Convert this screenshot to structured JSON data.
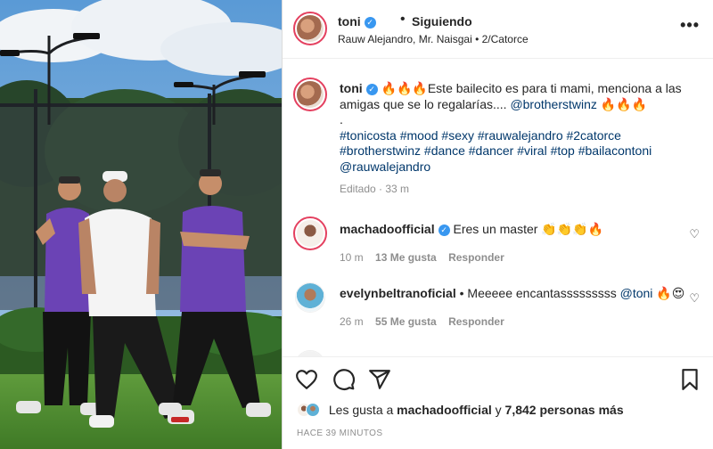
{
  "post": {
    "username": "toni",
    "follow_status": "Siguiendo",
    "audio": "Rauw Alejandro, Mr. Naisgai • 2/Catorce"
  },
  "caption": {
    "username": "toni",
    "text_fire_prefix": "🔥🔥🔥",
    "text_main": "Este bailecito es para ti mami, menciona a las amigas que se lo regalarías....",
    "mention": "@brotherstwinz",
    "text_fire_suffix": "🔥🔥🔥",
    "dot": ".",
    "hashtags": "#tonicosta #mood #sexy #rauwalejandro #2catorce #brotherstwinz #dance #dancer #viral #top #bailacontoni @rauwalejandro",
    "edited": "Editado",
    "age": "33 m"
  },
  "comments": [
    {
      "username": "machadoofficial",
      "verified": true,
      "text": "Eres un master 👏👏👏🔥",
      "age": "10 m",
      "likes": "13 Me gusta",
      "reply": "Responder"
    },
    {
      "username": "evelynbeltranoficial",
      "verified": false,
      "text": "Meeeee encantasssssssss",
      "mention": "@toni",
      "emoji": "🔥😍",
      "age": "26 m",
      "likes": "55 Me gusta",
      "reply": "Responder"
    }
  ],
  "likes_summary": {
    "prefix": "Les gusta a",
    "user": "machadoofficial",
    "and": "y",
    "count": "7,842 personas más"
  },
  "timestamp": "HACE 39 MINUTOS",
  "icons": {
    "verified": "✓",
    "more": "•••",
    "comment_heart": "♡"
  },
  "colors": {
    "verified_blue": "#3897f0",
    "link": "#00376b",
    "muted": "#8e8e8e",
    "story_ring": "#e4405f"
  }
}
